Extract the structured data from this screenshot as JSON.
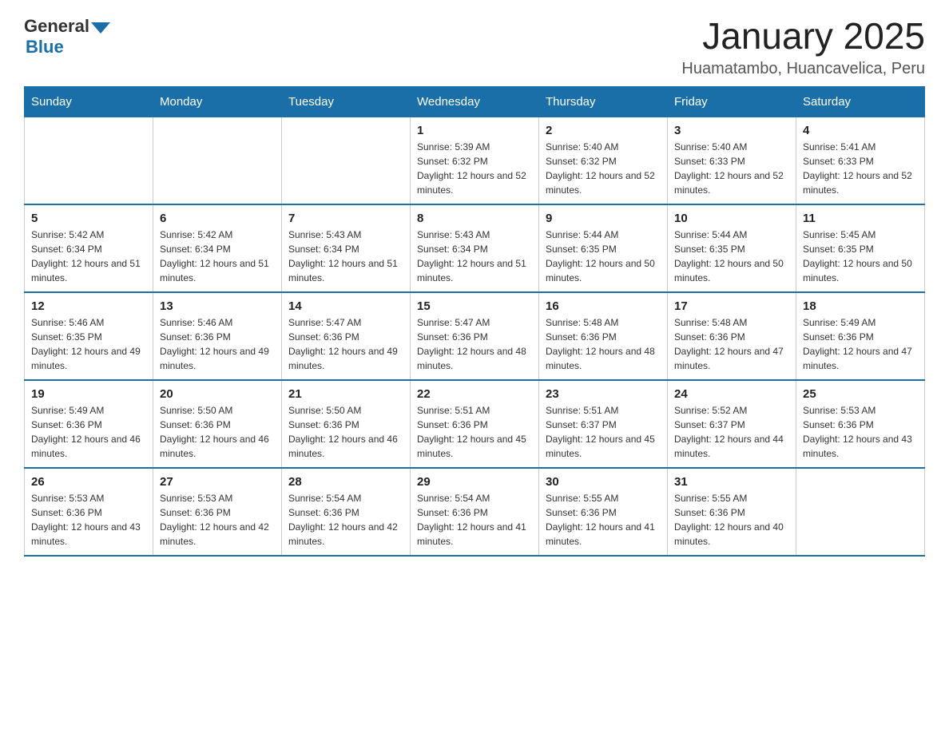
{
  "header": {
    "logo": {
      "general": "General",
      "blue": "Blue",
      "triangle": true
    },
    "title": "January 2025",
    "location": "Huamatambo, Huancavelica, Peru"
  },
  "calendar": {
    "days_of_week": [
      "Sunday",
      "Monday",
      "Tuesday",
      "Wednesday",
      "Thursday",
      "Friday",
      "Saturday"
    ],
    "weeks": [
      [
        {
          "day": "",
          "info": ""
        },
        {
          "day": "",
          "info": ""
        },
        {
          "day": "",
          "info": ""
        },
        {
          "day": "1",
          "info": "Sunrise: 5:39 AM\nSunset: 6:32 PM\nDaylight: 12 hours and 52 minutes."
        },
        {
          "day": "2",
          "info": "Sunrise: 5:40 AM\nSunset: 6:32 PM\nDaylight: 12 hours and 52 minutes."
        },
        {
          "day": "3",
          "info": "Sunrise: 5:40 AM\nSunset: 6:33 PM\nDaylight: 12 hours and 52 minutes."
        },
        {
          "day": "4",
          "info": "Sunrise: 5:41 AM\nSunset: 6:33 PM\nDaylight: 12 hours and 52 minutes."
        }
      ],
      [
        {
          "day": "5",
          "info": "Sunrise: 5:42 AM\nSunset: 6:34 PM\nDaylight: 12 hours and 51 minutes."
        },
        {
          "day": "6",
          "info": "Sunrise: 5:42 AM\nSunset: 6:34 PM\nDaylight: 12 hours and 51 minutes."
        },
        {
          "day": "7",
          "info": "Sunrise: 5:43 AM\nSunset: 6:34 PM\nDaylight: 12 hours and 51 minutes."
        },
        {
          "day": "8",
          "info": "Sunrise: 5:43 AM\nSunset: 6:34 PM\nDaylight: 12 hours and 51 minutes."
        },
        {
          "day": "9",
          "info": "Sunrise: 5:44 AM\nSunset: 6:35 PM\nDaylight: 12 hours and 50 minutes."
        },
        {
          "day": "10",
          "info": "Sunrise: 5:44 AM\nSunset: 6:35 PM\nDaylight: 12 hours and 50 minutes."
        },
        {
          "day": "11",
          "info": "Sunrise: 5:45 AM\nSunset: 6:35 PM\nDaylight: 12 hours and 50 minutes."
        }
      ],
      [
        {
          "day": "12",
          "info": "Sunrise: 5:46 AM\nSunset: 6:35 PM\nDaylight: 12 hours and 49 minutes."
        },
        {
          "day": "13",
          "info": "Sunrise: 5:46 AM\nSunset: 6:36 PM\nDaylight: 12 hours and 49 minutes."
        },
        {
          "day": "14",
          "info": "Sunrise: 5:47 AM\nSunset: 6:36 PM\nDaylight: 12 hours and 49 minutes."
        },
        {
          "day": "15",
          "info": "Sunrise: 5:47 AM\nSunset: 6:36 PM\nDaylight: 12 hours and 48 minutes."
        },
        {
          "day": "16",
          "info": "Sunrise: 5:48 AM\nSunset: 6:36 PM\nDaylight: 12 hours and 48 minutes."
        },
        {
          "day": "17",
          "info": "Sunrise: 5:48 AM\nSunset: 6:36 PM\nDaylight: 12 hours and 47 minutes."
        },
        {
          "day": "18",
          "info": "Sunrise: 5:49 AM\nSunset: 6:36 PM\nDaylight: 12 hours and 47 minutes."
        }
      ],
      [
        {
          "day": "19",
          "info": "Sunrise: 5:49 AM\nSunset: 6:36 PM\nDaylight: 12 hours and 46 minutes."
        },
        {
          "day": "20",
          "info": "Sunrise: 5:50 AM\nSunset: 6:36 PM\nDaylight: 12 hours and 46 minutes."
        },
        {
          "day": "21",
          "info": "Sunrise: 5:50 AM\nSunset: 6:36 PM\nDaylight: 12 hours and 46 minutes."
        },
        {
          "day": "22",
          "info": "Sunrise: 5:51 AM\nSunset: 6:36 PM\nDaylight: 12 hours and 45 minutes."
        },
        {
          "day": "23",
          "info": "Sunrise: 5:51 AM\nSunset: 6:37 PM\nDaylight: 12 hours and 45 minutes."
        },
        {
          "day": "24",
          "info": "Sunrise: 5:52 AM\nSunset: 6:37 PM\nDaylight: 12 hours and 44 minutes."
        },
        {
          "day": "25",
          "info": "Sunrise: 5:53 AM\nSunset: 6:36 PM\nDaylight: 12 hours and 43 minutes."
        }
      ],
      [
        {
          "day": "26",
          "info": "Sunrise: 5:53 AM\nSunset: 6:36 PM\nDaylight: 12 hours and 43 minutes."
        },
        {
          "day": "27",
          "info": "Sunrise: 5:53 AM\nSunset: 6:36 PM\nDaylight: 12 hours and 42 minutes."
        },
        {
          "day": "28",
          "info": "Sunrise: 5:54 AM\nSunset: 6:36 PM\nDaylight: 12 hours and 42 minutes."
        },
        {
          "day": "29",
          "info": "Sunrise: 5:54 AM\nSunset: 6:36 PM\nDaylight: 12 hours and 41 minutes."
        },
        {
          "day": "30",
          "info": "Sunrise: 5:55 AM\nSunset: 6:36 PM\nDaylight: 12 hours and 41 minutes."
        },
        {
          "day": "31",
          "info": "Sunrise: 5:55 AM\nSunset: 6:36 PM\nDaylight: 12 hours and 40 minutes."
        },
        {
          "day": "",
          "info": ""
        }
      ]
    ]
  }
}
